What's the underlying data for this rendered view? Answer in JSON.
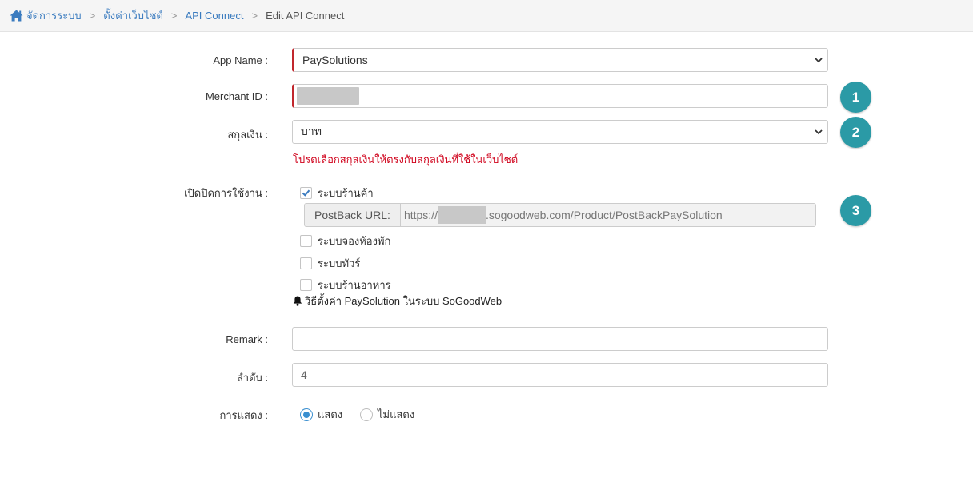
{
  "breadcrumb": {
    "home": "จัดการระบบ",
    "settings": "ตั้งค่าเว็บไซต์",
    "api_connect": "API Connect",
    "current": "Edit API Connect",
    "home_icon": "home-icon",
    "separator": ">"
  },
  "form": {
    "app_name": {
      "label": "App Name :",
      "value": "PaySolutions"
    },
    "merchant_id": {
      "label": "Merchant ID :",
      "value": ""
    },
    "currency": {
      "label": "สกุลเงิน :",
      "value": "บาท",
      "hint": "โปรดเลือกสกุลเงินให้ตรงกับสกุลเงินที่ใช้ในเว็บไซต์"
    },
    "enable": {
      "label": "เปิดปิดการใช้งาน :",
      "options": [
        {
          "label": "ระบบร้านค้า",
          "checked": true
        },
        {
          "label": "ระบบจองห้องพัก",
          "checked": false
        },
        {
          "label": "ระบบทัวร์",
          "checked": false
        },
        {
          "label": "ระบบร้านอาหาร",
          "checked": false
        }
      ],
      "postback": {
        "label": "PostBack URL:",
        "prefix": "https://",
        "suffix": ".sogoodweb.com/Product/PostBackPaySolution"
      },
      "guide": "วิธีตั้งค่า PaySolution ในระบบ SoGoodWeb"
    },
    "remark": {
      "label": "Remark :",
      "value": ""
    },
    "order": {
      "label": "ลำดับ :",
      "value": "4"
    },
    "display": {
      "label": "การแสดง :",
      "options": [
        {
          "label": "แสดง",
          "selected": true
        },
        {
          "label": "ไม่แสดง",
          "selected": false
        }
      ]
    }
  },
  "badges": [
    "1",
    "2",
    "3"
  ],
  "colors": {
    "link": "#3a7bbf",
    "required": "#c1272d",
    "error": "#d0021b",
    "badge": "#2b9aa6",
    "radio": "#3a8fd0"
  }
}
